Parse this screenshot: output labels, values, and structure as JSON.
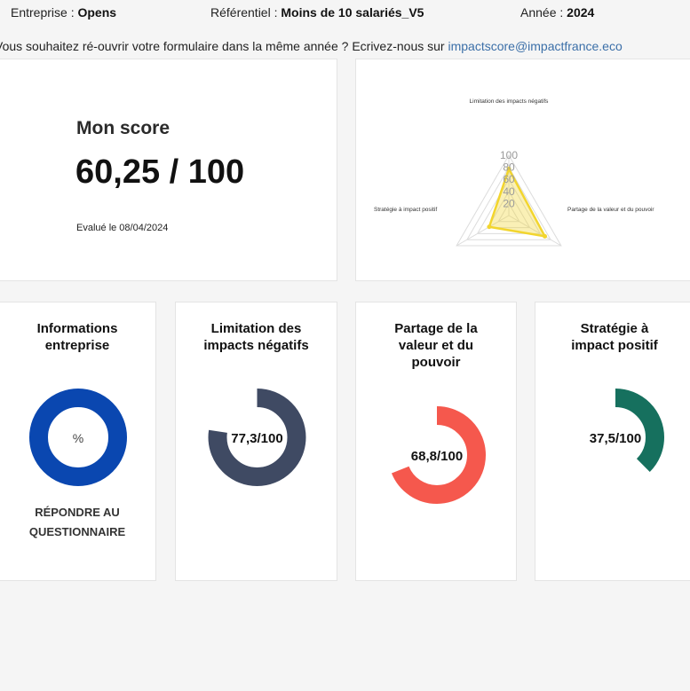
{
  "header": {
    "entreprise_label": "Entreprise :",
    "entreprise_value": "Opens",
    "referentiel_label": "Référentiel :",
    "referentiel_value": "Moins de 10 salariés_V5",
    "annee_label": "Année :",
    "annee_value": "2024"
  },
  "notice": {
    "text": "Vous souhaitez ré-ouvrir votre formulaire dans la même année ? Ecrivez-nous sur ",
    "email": "impactscore@impactfrance.eco"
  },
  "score": {
    "title": "Mon score",
    "value": "60,25 / 100",
    "evaluated": "Evalué le 08/04/2024"
  },
  "colors": {
    "informations": "#0a47b0",
    "limitation": "#3f4a63",
    "partage": "#f5584d",
    "strategie": "#16705e",
    "radar": "#f2d52e"
  },
  "chart_data": {
    "type": "radar",
    "axes": [
      "Limitation des impacts négatifs",
      "Partage de la valeur et du pouvoir",
      "Stratégie à impact positif"
    ],
    "tick_labels": [
      "20",
      "40",
      "60",
      "80",
      "100"
    ],
    "range": [
      0,
      100
    ],
    "series": [
      {
        "values": [
          77.3,
          68.8,
          37.5
        ]
      }
    ]
  },
  "dimensions": [
    {
      "title_lines": [
        "Informations",
        "entreprise"
      ],
      "center_text": "%",
      "cta_lines": [
        "RÉPONDRE AU",
        "QUESTIONNAIRE"
      ],
      "progress": 1.0,
      "color_key": "informations"
    },
    {
      "title_lines": [
        "Limitation des",
        "impacts négatifs"
      ],
      "center_text": "77,3/100",
      "progress": 0.773,
      "color_key": "limitation"
    },
    {
      "title_lines": [
        "Partage de la",
        "valeur et du",
        "pouvoir"
      ],
      "center_text": "68,8/100",
      "progress": 0.688,
      "color_key": "partage"
    },
    {
      "title_lines": [
        "Stratégie à",
        "impact positif"
      ],
      "center_text": "37,5/100",
      "progress": 0.375,
      "color_key": "strategie"
    }
  ]
}
